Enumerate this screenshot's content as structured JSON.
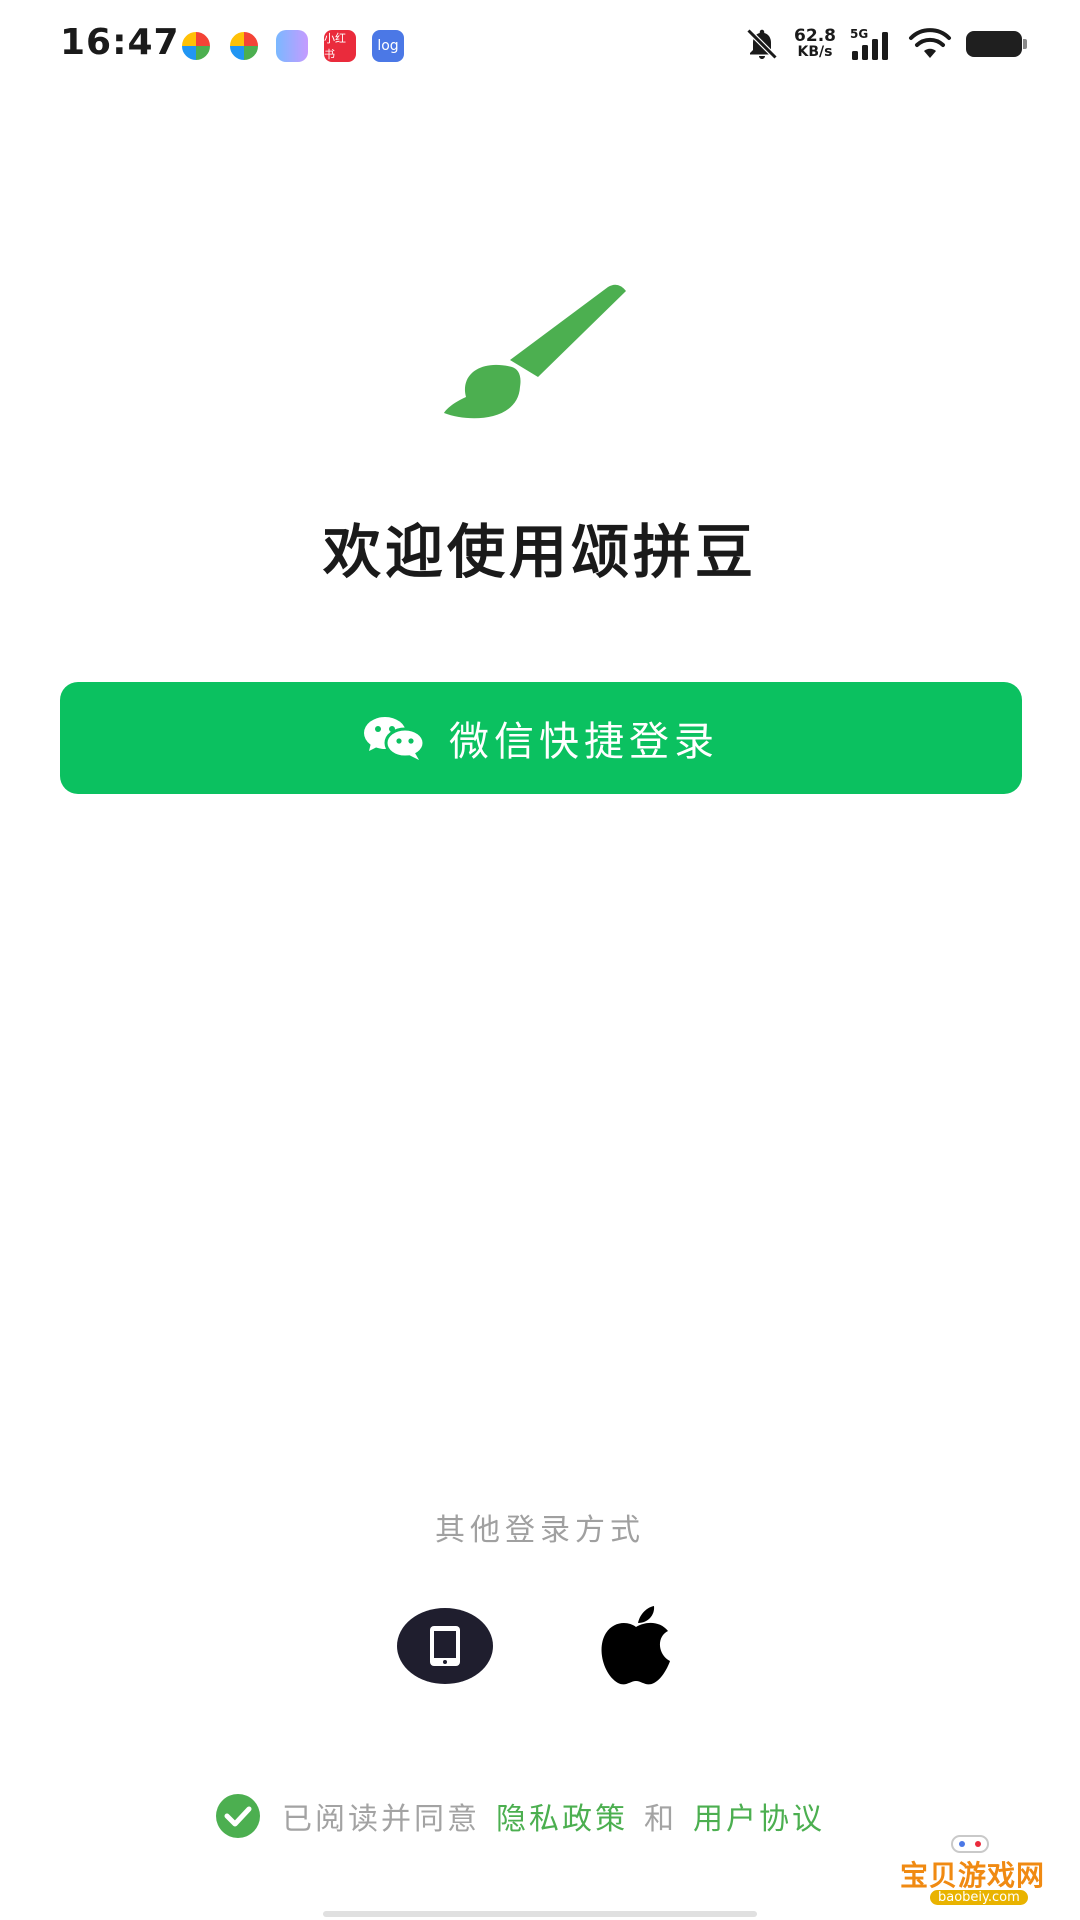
{
  "status_bar": {
    "time": "16:47",
    "notifications": [
      {
        "icon": "app-circle-icon",
        "text": ""
      },
      {
        "icon": "app-circle-icon",
        "text": ""
      },
      {
        "icon": "app-blob-icon",
        "text": ""
      },
      {
        "icon": "xiaohongshu-icon",
        "text": "小红书"
      },
      {
        "icon": "log-icon",
        "text": "log"
      }
    ],
    "net_speed_value": "62.8",
    "net_speed_unit": "KB/s",
    "network_type": "5G"
  },
  "app": {
    "brand_color": "#4caf50",
    "welcome_title": "欢迎使用颂拼豆"
  },
  "login": {
    "wechat_button_label": "微信快捷登录",
    "wechat_button_color": "#0bc160",
    "other_methods_title": "其他登录方式",
    "other_methods": [
      {
        "icon": "phone-icon"
      },
      {
        "icon": "apple-icon"
      }
    ]
  },
  "agreement": {
    "checked": true,
    "prefix": "已阅读并同意",
    "privacy_link": "隐私政策",
    "connector": "和",
    "terms_link": "用户协议"
  },
  "watermark": {
    "main": "宝贝游戏网",
    "sub": "baobeiy.com"
  }
}
